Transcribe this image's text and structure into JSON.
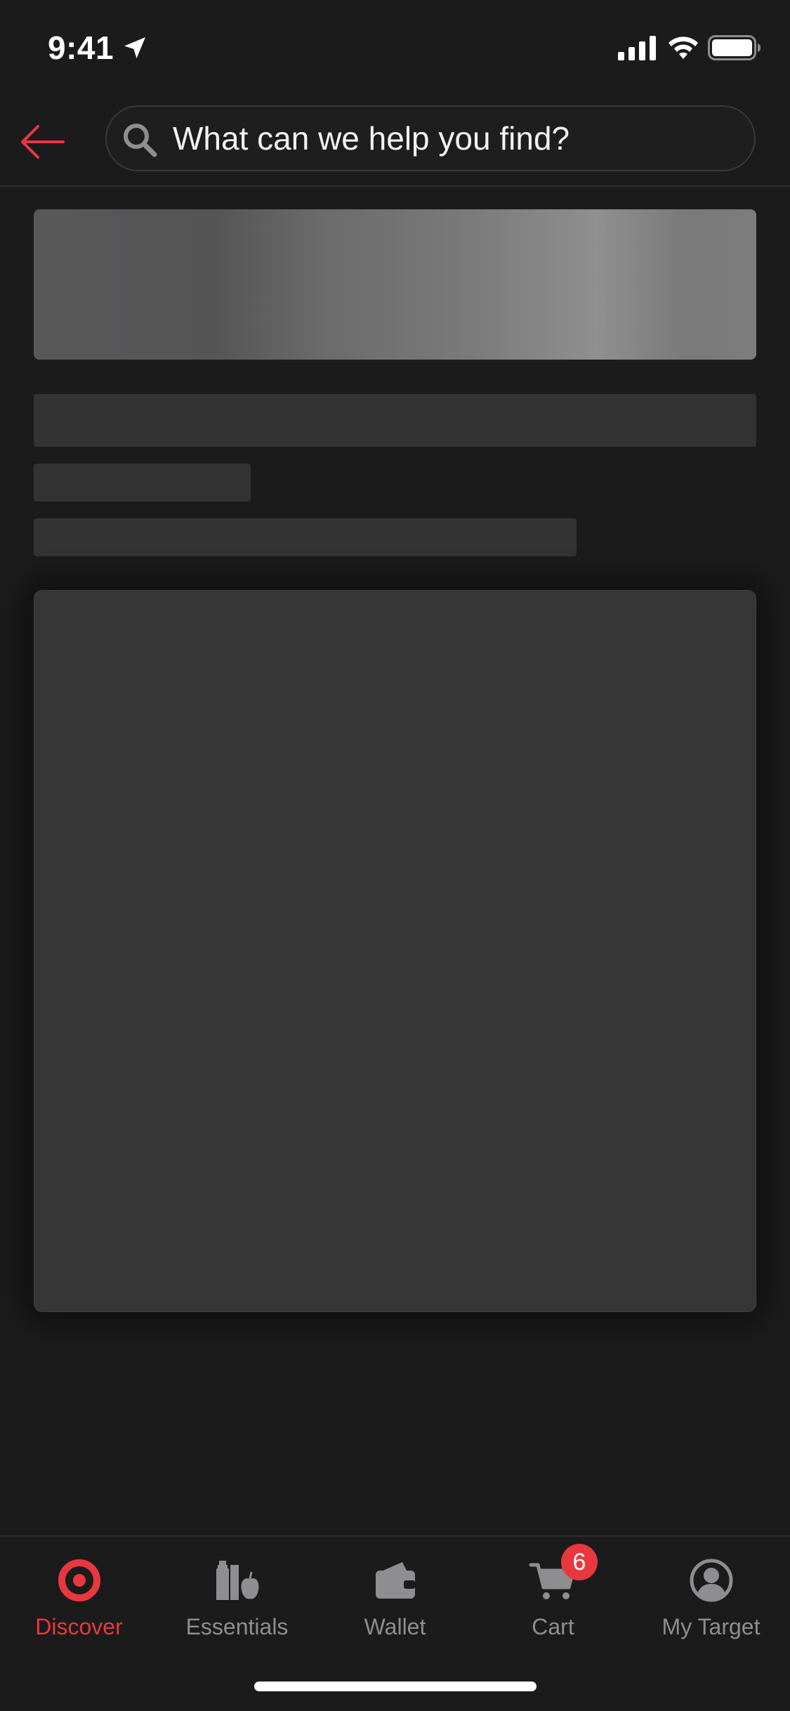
{
  "status_bar": {
    "time": "9:41",
    "icons": {
      "location": "location-arrow-icon",
      "signal": "cellular-signal-icon",
      "wifi": "wifi-icon",
      "battery": "battery-full-icon"
    }
  },
  "header": {
    "back_icon": "arrow-left-icon",
    "search": {
      "placeholder": "What can we help you find?",
      "value": ""
    }
  },
  "tabs": [
    {
      "label": "Discover",
      "icon": "target-logo-icon",
      "active": true
    },
    {
      "label": "Essentials",
      "icon": "grocery-icon",
      "active": false
    },
    {
      "label": "Wallet",
      "icon": "wallet-icon",
      "active": false
    },
    {
      "label": "Cart",
      "icon": "cart-icon",
      "active": false,
      "badge": "6"
    },
    {
      "label": "My Target",
      "icon": "account-icon",
      "active": false
    }
  ],
  "colors": {
    "background": "#1b1b1c",
    "accent": "#e8383f",
    "tab_inactive": "#8e8e90",
    "skeleton": "#333334"
  }
}
